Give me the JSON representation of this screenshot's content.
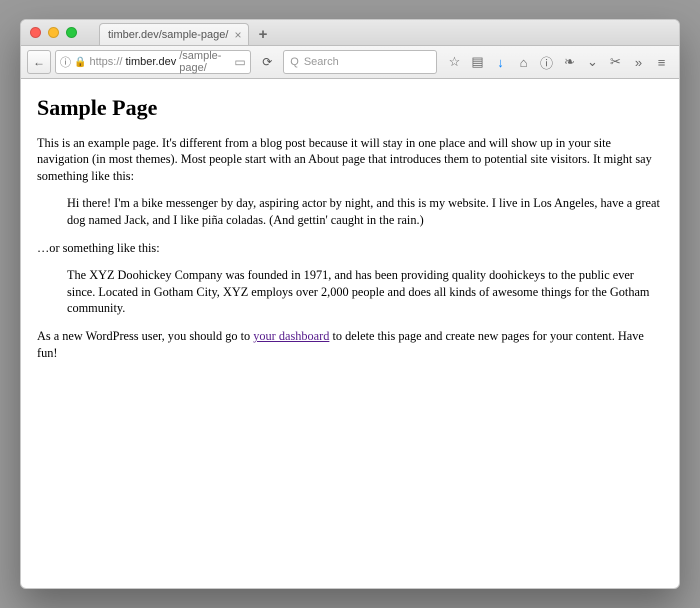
{
  "window": {
    "tab_title": "timber.dev/sample-page/",
    "new_tab": "+",
    "close_tab": "×"
  },
  "toolbar": {
    "back": "←",
    "info": "ⓘ",
    "lock_icon": "🔒",
    "url_proto": "https://",
    "url_host": "timber.dev",
    "url_path": "/sample-page/",
    "reader": "▭",
    "reload": "⟳",
    "search_placeholder": "Search",
    "search_icon": "Q"
  },
  "icons": {
    "star": "☆",
    "list": "▤",
    "download": "↓",
    "home": "⌂",
    "info2": "ⓘ",
    "evernote": "❧",
    "pocket": "⌄",
    "scissors": "✂",
    "more": "»",
    "menu": "≡"
  },
  "page": {
    "title": "Sample Page",
    "p1": "This is an example page. It's different from a blog post because it will stay in one place and will show up in your site navigation (in most themes). Most people start with an About page that introduces them to potential site visitors. It might say something like this:",
    "quote1": "Hi there! I'm a bike messenger by day, aspiring actor by night, and this is my website. I live in Los Angeles, have a great dog named Jack, and I like piña coladas. (And gettin' caught in the rain.)",
    "p2": "…or something like this:",
    "quote2": "The XYZ Doohickey Company was founded in 1971, and has been providing quality doohickeys to the public ever since. Located in Gotham City, XYZ employs over 2,000 people and does all kinds of awesome things for the Gotham community.",
    "p3a": "As a new WordPress user, you should go to ",
    "p3_link": "your dashboard",
    "p3b": " to delete this page and create new pages for your content. Have fun!"
  }
}
